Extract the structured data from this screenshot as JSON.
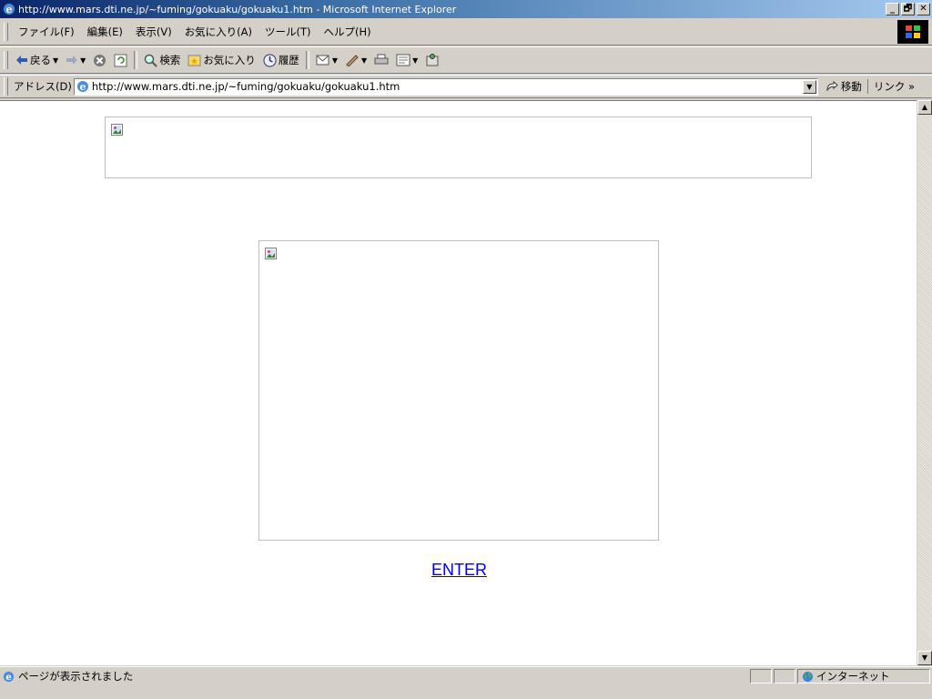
{
  "window": {
    "title": "http://www.mars.dti.ne.jp/~fuming/gokuaku/gokuaku1.htm - Microsoft Internet Explorer",
    "buttons": [
      "_",
      "🗗",
      "✕"
    ]
  },
  "menubar": {
    "items": [
      "ファイル(F)",
      "編集(E)",
      "表示(V)",
      "お気に入り(A)",
      "ツール(T)",
      "ヘルプ(H)"
    ]
  },
  "toolbar": {
    "back_label": "戻る",
    "search_label": "検索",
    "favorites_label": "お気に入り",
    "history_label": "履歴"
  },
  "addressbar": {
    "label": "アドレス(D)",
    "url": "http://www.mars.dti.ne.jp/~fuming/gokuaku/gokuaku1.htm",
    "go_label": "移動",
    "links_label": "リンク »"
  },
  "page": {
    "enter_link": "ENTER"
  },
  "statusbar": {
    "text": "ページが表示されました",
    "zone": "インターネット"
  },
  "icons": [
    "ie-icon",
    "back-icon",
    "forward-icon",
    "stop-icon",
    "refresh-icon",
    "search-icon",
    "favorites-icon",
    "history-icon",
    "mail-icon",
    "edit-icon",
    "print-icon",
    "discuss-icon",
    "messenger-icon",
    "go-icon",
    "broken-image-icon",
    "globe-icon",
    "windows-logo-icon"
  ]
}
